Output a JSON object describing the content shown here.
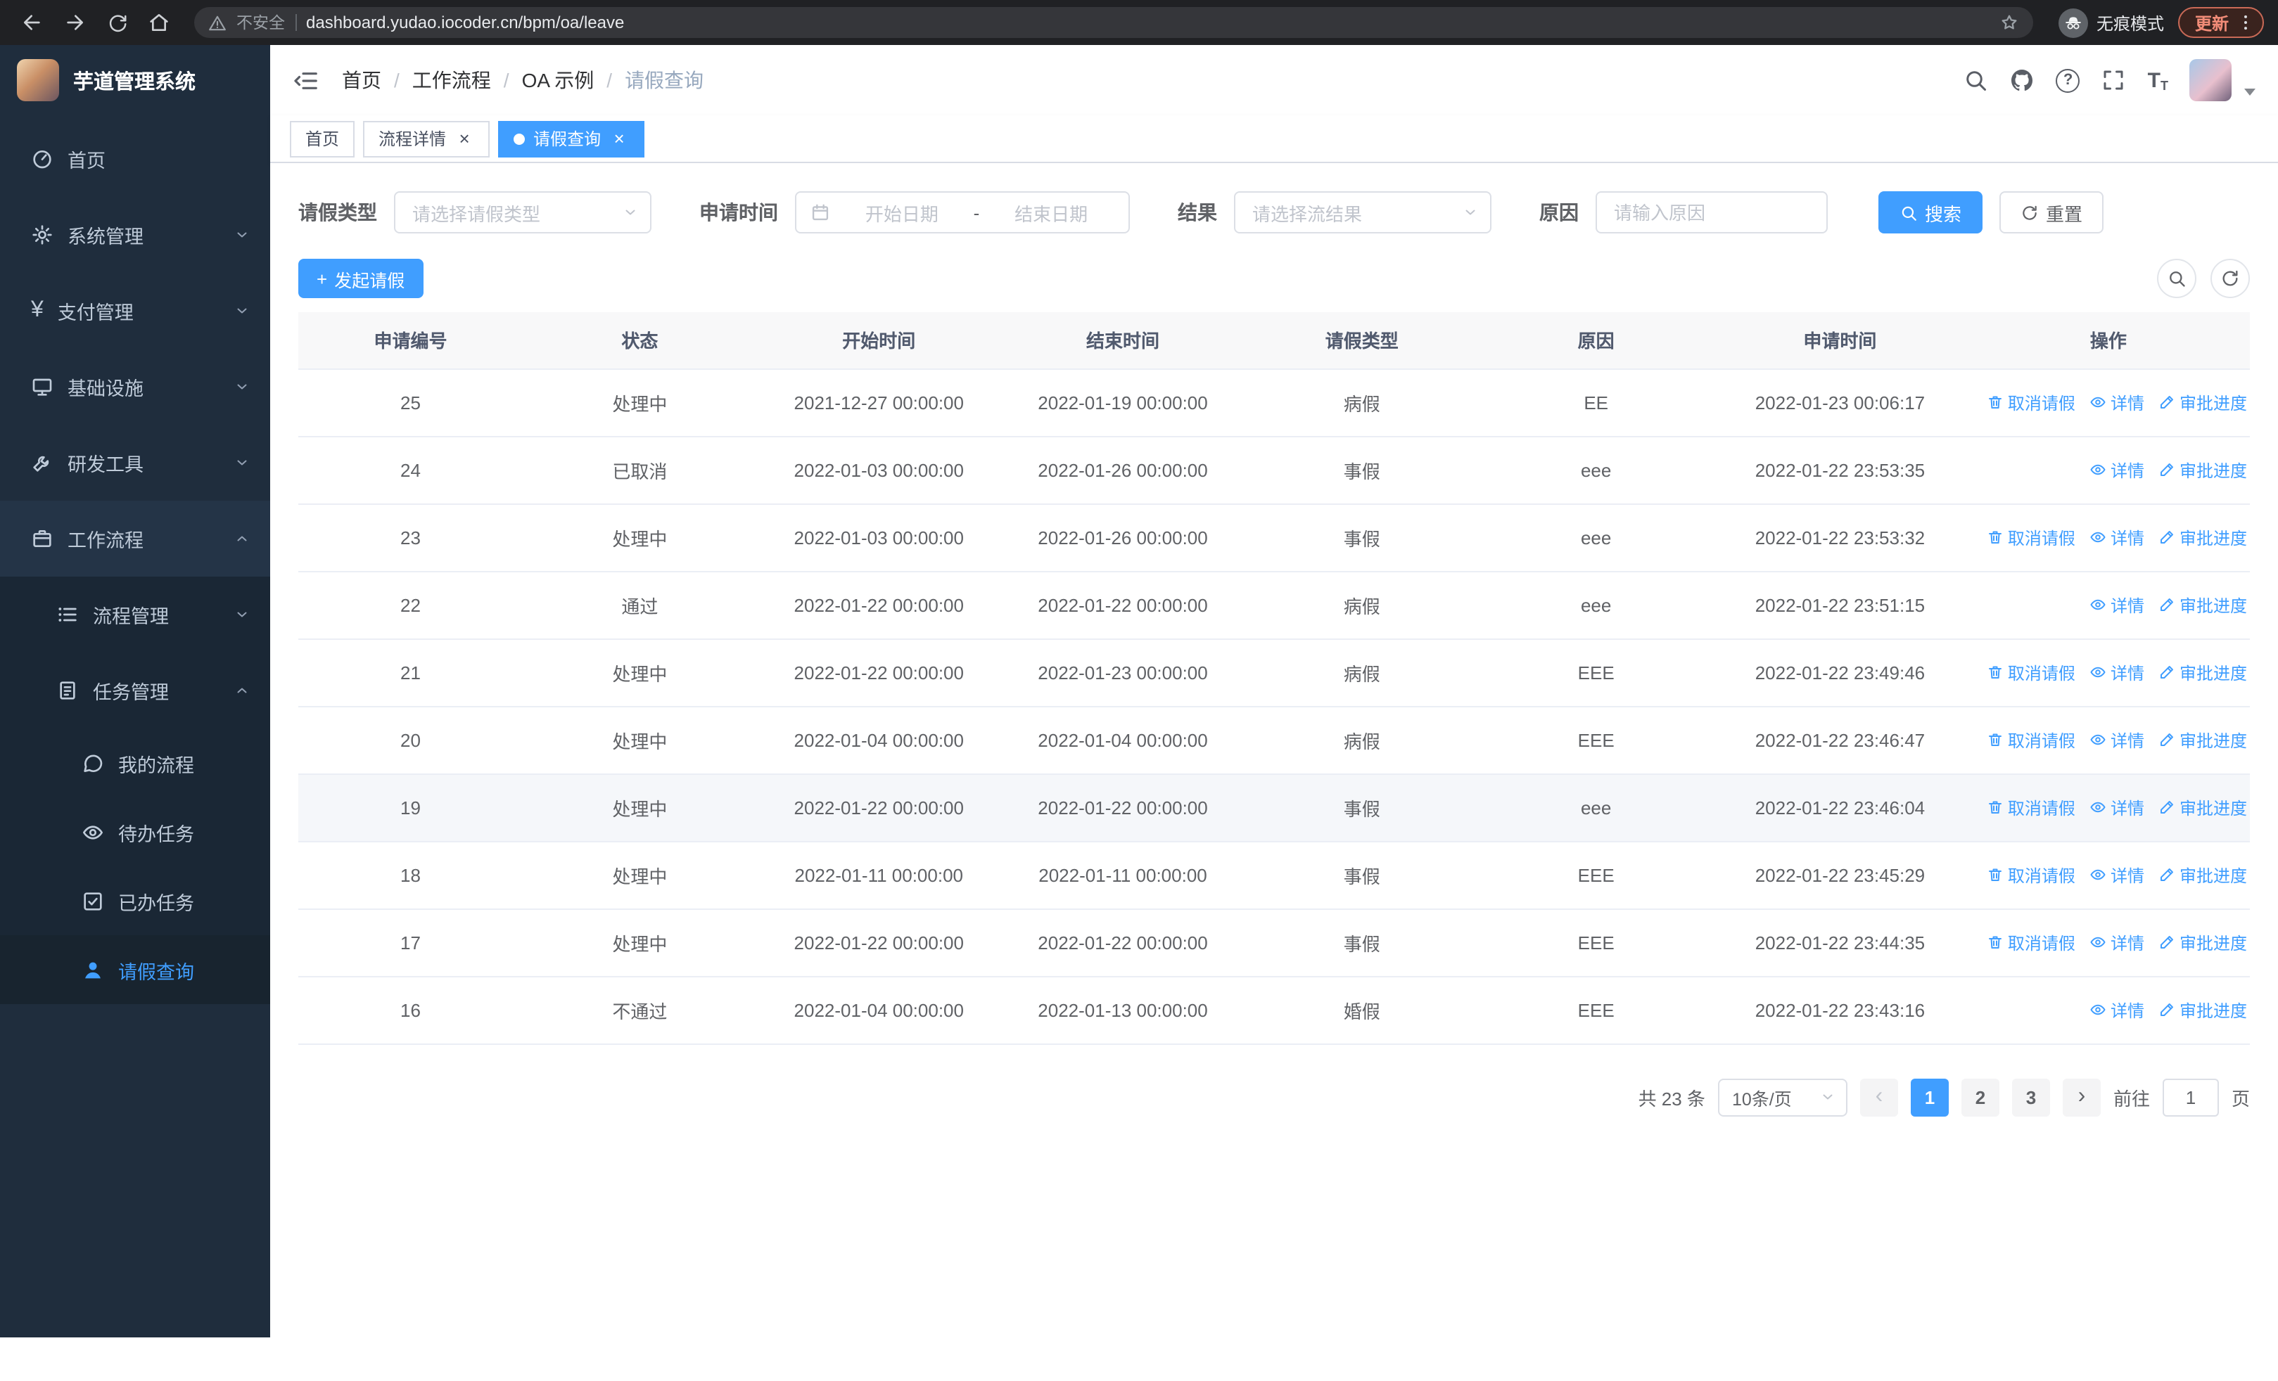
{
  "browser": {
    "security_label": "不安全",
    "url": "dashboard.yudao.iocoder.cn/bpm/oa/leave",
    "incognito_label": "无痕模式",
    "update_label": "更新"
  },
  "colors": {
    "accent": "#409eff",
    "sidebar_bg": "#1f2d3d",
    "tab_active_bg": "#409eff",
    "link": "#409eff",
    "table_header_bg": "#f8f8f9"
  },
  "sidebar": {
    "logo_title": "芋道管理系统",
    "items": [
      {
        "key": "home",
        "label": "首页",
        "icon": "dashboard-icon",
        "level": 1
      },
      {
        "key": "system-management",
        "label": "系统管理",
        "icon": "gear-icon",
        "level": 1,
        "chevron": "down"
      },
      {
        "key": "payment-management",
        "label": "支付管理",
        "icon": "yen-icon",
        "level": 1,
        "chevron": "down"
      },
      {
        "key": "infrastructure",
        "label": "基础设施",
        "icon": "infra-icon",
        "level": 1,
        "chevron": "down"
      },
      {
        "key": "dev-tools",
        "label": "研发工具",
        "icon": "tools-icon",
        "level": 1,
        "chevron": "down"
      },
      {
        "key": "workflow",
        "label": "工作流程",
        "icon": "workflow-icon",
        "level": 1,
        "chevron": "up",
        "open": true
      },
      {
        "key": "process-management",
        "label": "流程管理",
        "icon": "process-icon",
        "level": 2,
        "chevron": "down"
      },
      {
        "key": "task-management",
        "label": "任务管理",
        "icon": "task-icon",
        "level": 2,
        "chevron": "up",
        "open": true
      },
      {
        "key": "my-process",
        "label": "我的流程",
        "icon": "chat-icon",
        "level": 3
      },
      {
        "key": "todo-tasks",
        "label": "待办任务",
        "icon": "eye-icon",
        "level": 3
      },
      {
        "key": "done-tasks",
        "label": "已办任务",
        "icon": "done-icon",
        "level": 3
      },
      {
        "key": "leave-query",
        "label": "请假查询",
        "icon": "user-icon",
        "level": 3,
        "active": true
      }
    ]
  },
  "header": {
    "breadcrumb": [
      "首页",
      "工作流程",
      "OA 示例",
      "请假查询"
    ]
  },
  "tabs": [
    {
      "key": "home",
      "label": "首页",
      "active": false,
      "closable": false
    },
    {
      "key": "process-detail",
      "label": "流程详情",
      "active": false,
      "closable": true
    },
    {
      "key": "leave-query",
      "label": "请假查询",
      "active": true,
      "closable": true
    }
  ],
  "filters": {
    "leave_type_label": "请假类型",
    "leave_type_placeholder": "请选择请假类型",
    "apply_time_label": "申请时间",
    "start_date_placeholder": "开始日期",
    "range_separator": "-",
    "end_date_placeholder": "结束日期",
    "result_label": "结果",
    "result_placeholder": "请选择流结果",
    "reason_label": "原因",
    "reason_placeholder": "请输入原因",
    "search_label": "搜索",
    "reset_label": "重置"
  },
  "toolbar": {
    "create_label": "发起请假"
  },
  "table": {
    "columns": [
      "申请编号",
      "状态",
      "开始时间",
      "结束时间",
      "请假类型",
      "原因",
      "申请时间",
      "操作"
    ],
    "action_labels": {
      "cancel": "取消请假",
      "detail": "详情",
      "progress": "审批进度"
    },
    "rows": [
      {
        "id": "25",
        "status": "处理中",
        "start": "2021-12-27 00:00:00",
        "end": "2022-01-19 00:00:00",
        "type": "病假",
        "reason": "EE",
        "apply_time": "2022-01-23 00:06:17",
        "can_cancel": true
      },
      {
        "id": "24",
        "status": "已取消",
        "start": "2022-01-03 00:00:00",
        "end": "2022-01-26 00:00:00",
        "type": "事假",
        "reason": "eee",
        "apply_time": "2022-01-22 23:53:35",
        "can_cancel": false
      },
      {
        "id": "23",
        "status": "处理中",
        "start": "2022-01-03 00:00:00",
        "end": "2022-01-26 00:00:00",
        "type": "事假",
        "reason": "eee",
        "apply_time": "2022-01-22 23:53:32",
        "can_cancel": true
      },
      {
        "id": "22",
        "status": "通过",
        "start": "2022-01-22 00:00:00",
        "end": "2022-01-22 00:00:00",
        "type": "病假",
        "reason": "eee",
        "apply_time": "2022-01-22 23:51:15",
        "can_cancel": false
      },
      {
        "id": "21",
        "status": "处理中",
        "start": "2022-01-22 00:00:00",
        "end": "2022-01-23 00:00:00",
        "type": "病假",
        "reason": "EEE",
        "apply_time": "2022-01-22 23:49:46",
        "can_cancel": true
      },
      {
        "id": "20",
        "status": "处理中",
        "start": "2022-01-04 00:00:00",
        "end": "2022-01-04 00:00:00",
        "type": "病假",
        "reason": "EEE",
        "apply_time": "2022-01-22 23:46:47",
        "can_cancel": true
      },
      {
        "id": "19",
        "status": "处理中",
        "start": "2022-01-22 00:00:00",
        "end": "2022-01-22 00:00:00",
        "type": "事假",
        "reason": "eee",
        "apply_time": "2022-01-22 23:46:04",
        "can_cancel": true,
        "highlighted": true
      },
      {
        "id": "18",
        "status": "处理中",
        "start": "2022-01-11 00:00:00",
        "end": "2022-01-11 00:00:00",
        "type": "事假",
        "reason": "EEE",
        "apply_time": "2022-01-22 23:45:29",
        "can_cancel": true
      },
      {
        "id": "17",
        "status": "处理中",
        "start": "2022-01-22 00:00:00",
        "end": "2022-01-22 00:00:00",
        "type": "事假",
        "reason": "EEE",
        "apply_time": "2022-01-22 23:44:35",
        "can_cancel": true
      },
      {
        "id": "16",
        "status": "不通过",
        "start": "2022-01-04 00:00:00",
        "end": "2022-01-13 00:00:00",
        "type": "婚假",
        "reason": "EEE",
        "apply_time": "2022-01-22 23:43:16",
        "can_cancel": false
      }
    ]
  },
  "pagination": {
    "total": "共 23 条",
    "page_size": "10条/页",
    "pages": [
      "1",
      "2",
      "3"
    ],
    "active_page": "1",
    "prev_symbol": "‹",
    "next_symbol": "›",
    "goto_label": "前往",
    "goto_value": "1",
    "unit_label": "页"
  }
}
